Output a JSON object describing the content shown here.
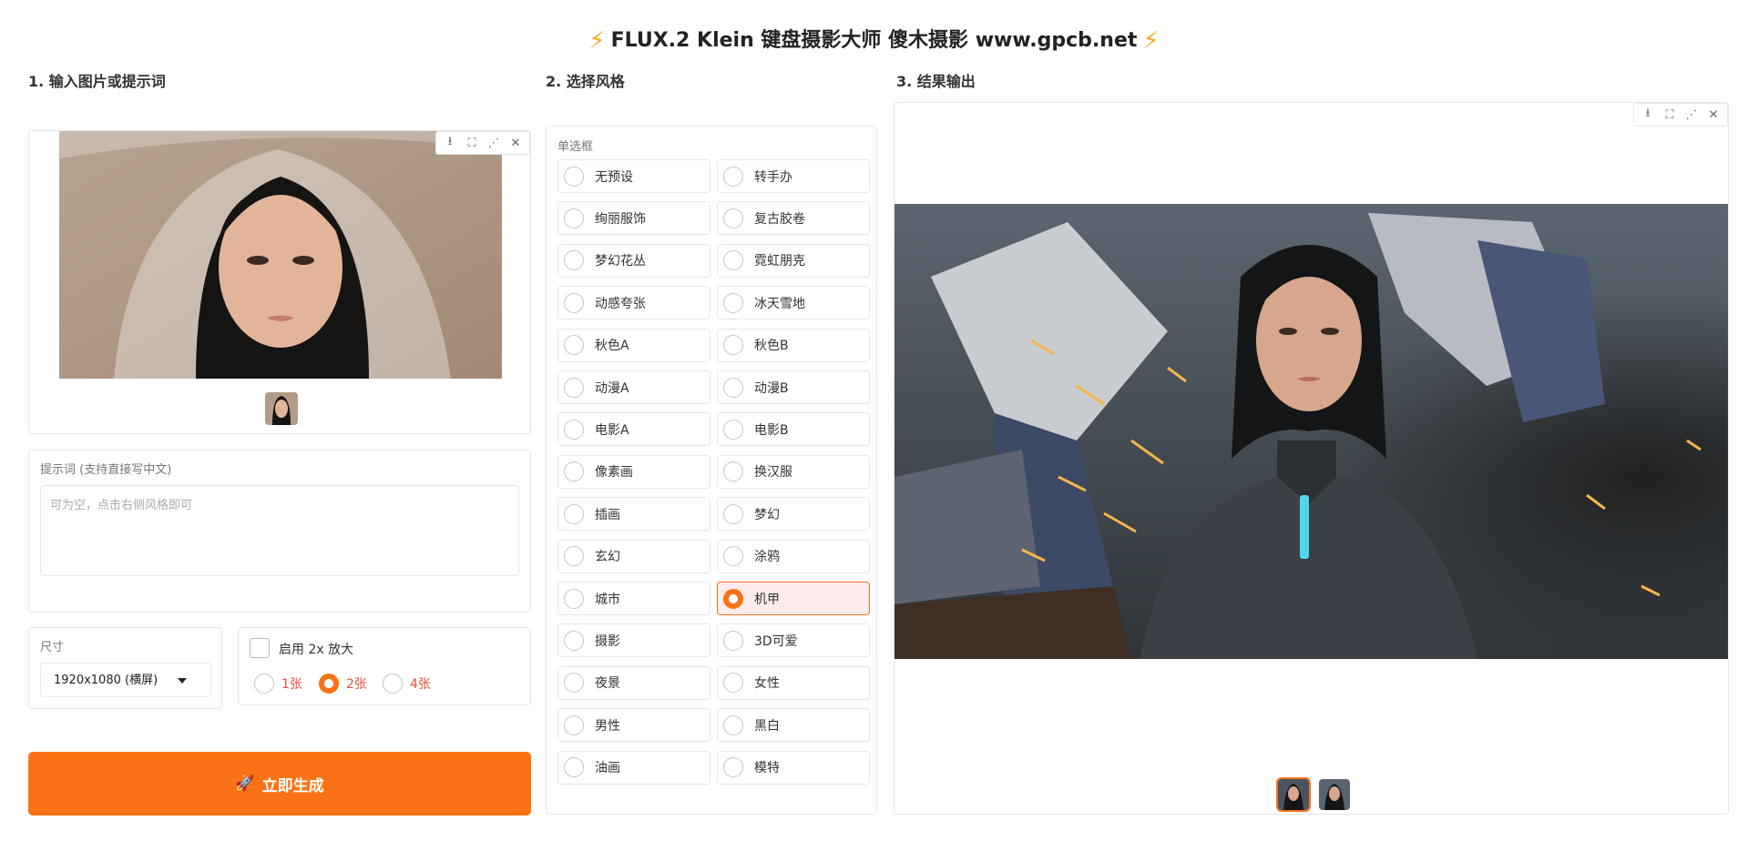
{
  "header": {
    "title": "FLUX.2 Klein 键盘摄影大师 傻木摄影 www.gpcb.net"
  },
  "columns": {
    "input_title": "1. 输入图片或提示词",
    "style_title": "2. 选择风格",
    "output_title": "3. 结果输出"
  },
  "input": {
    "prompt_label": "提示词 (支持直接写中文)",
    "prompt_placeholder": "可为空，点击右侧风格即可",
    "prompt_value": "",
    "size_label": "尺寸",
    "size_value": "1920x1080 (横屏)",
    "upscale_label": "启用 2x 放大",
    "counts": [
      {
        "label": "1张",
        "selected": false
      },
      {
        "label": "2张",
        "selected": true
      },
      {
        "label": "4张",
        "selected": false
      }
    ],
    "generate_label": "立即生成"
  },
  "styles": {
    "group_label": "单选框",
    "selected": "机甲",
    "options": [
      "无预设",
      "转手办",
      "绚丽服饰",
      "复古胶卷",
      "梦幻花丛",
      "霓虹朋克",
      "动感夸张",
      "冰天雪地",
      "秋色A",
      "秋色B",
      "动漫A",
      "动漫B",
      "电影A",
      "电影B",
      "像素画",
      "换汉服",
      "插画",
      "梦幻",
      "玄幻",
      "涂鸦",
      "城市",
      "机甲",
      "摄影",
      "3D可爱",
      "夜景",
      "女性",
      "男性",
      "黑白",
      "油画",
      "模特"
    ]
  },
  "colors": {
    "accent": "#f97316",
    "selected_bg": "#fdecec",
    "count_text": "#e0533f"
  },
  "icons": [
    "download-icon",
    "fullscreen-icon",
    "share-icon",
    "close-icon",
    "bolt-icon",
    "rocket-icon"
  ]
}
